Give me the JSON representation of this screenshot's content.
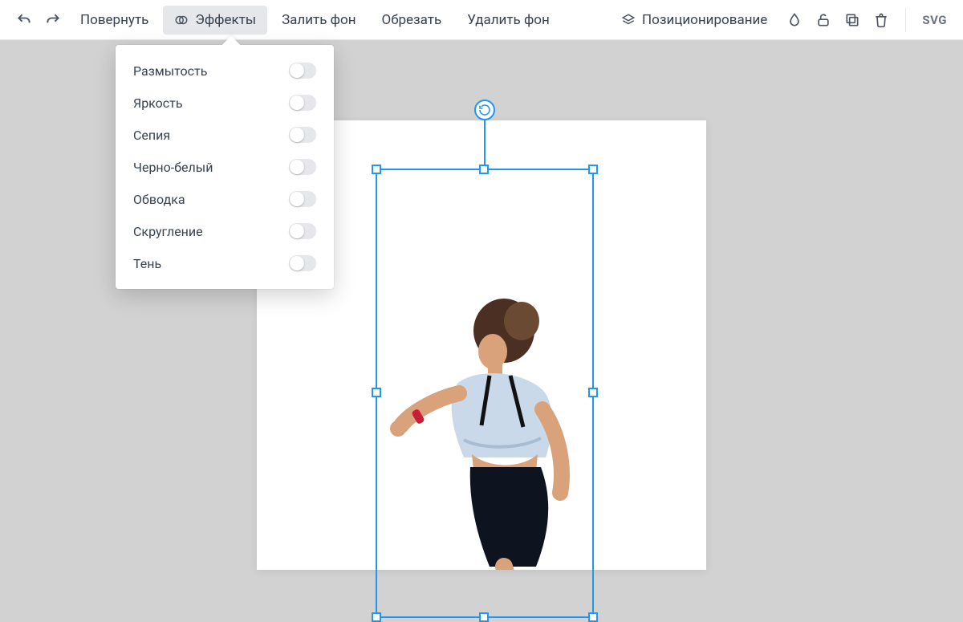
{
  "toolbar": {
    "rotate_label": "Повернуть",
    "effects_label": "Эффекты",
    "fill_bg_label": "Залить фон",
    "crop_label": "Обрезать",
    "remove_bg_label": "Удалить фон",
    "positioning_label": "Позиционирование",
    "svg_badge": "SVG"
  },
  "effects_dropdown": {
    "items": [
      {
        "label": "Размытость",
        "enabled": false
      },
      {
        "label": "Яркость",
        "enabled": false
      },
      {
        "label": "Сепия",
        "enabled": false
      },
      {
        "label": "Черно-белый",
        "enabled": false
      },
      {
        "label": "Обводка",
        "enabled": false
      },
      {
        "label": "Скругление",
        "enabled": false
      },
      {
        "label": "Тень",
        "enabled": false
      }
    ]
  },
  "colors": {
    "selection": "#2196f3",
    "toolbar_bg": "#ffffff",
    "canvas_bg": "#d2d2d2"
  }
}
